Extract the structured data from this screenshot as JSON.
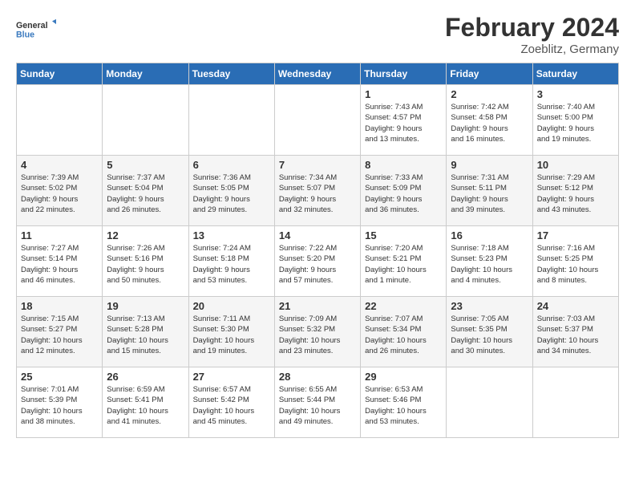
{
  "logo": {
    "text_general": "General",
    "text_blue": "Blue"
  },
  "title": "February 2024",
  "subtitle": "Zoeblitz, Germany",
  "days_of_week": [
    "Sunday",
    "Monday",
    "Tuesday",
    "Wednesday",
    "Thursday",
    "Friday",
    "Saturday"
  ],
  "weeks": [
    [
      {
        "day": "",
        "info": ""
      },
      {
        "day": "",
        "info": ""
      },
      {
        "day": "",
        "info": ""
      },
      {
        "day": "",
        "info": ""
      },
      {
        "day": "1",
        "info": "Sunrise: 7:43 AM\nSunset: 4:57 PM\nDaylight: 9 hours\nand 13 minutes."
      },
      {
        "day": "2",
        "info": "Sunrise: 7:42 AM\nSunset: 4:58 PM\nDaylight: 9 hours\nand 16 minutes."
      },
      {
        "day": "3",
        "info": "Sunrise: 7:40 AM\nSunset: 5:00 PM\nDaylight: 9 hours\nand 19 minutes."
      }
    ],
    [
      {
        "day": "4",
        "info": "Sunrise: 7:39 AM\nSunset: 5:02 PM\nDaylight: 9 hours\nand 22 minutes."
      },
      {
        "day": "5",
        "info": "Sunrise: 7:37 AM\nSunset: 5:04 PM\nDaylight: 9 hours\nand 26 minutes."
      },
      {
        "day": "6",
        "info": "Sunrise: 7:36 AM\nSunset: 5:05 PM\nDaylight: 9 hours\nand 29 minutes."
      },
      {
        "day": "7",
        "info": "Sunrise: 7:34 AM\nSunset: 5:07 PM\nDaylight: 9 hours\nand 32 minutes."
      },
      {
        "day": "8",
        "info": "Sunrise: 7:33 AM\nSunset: 5:09 PM\nDaylight: 9 hours\nand 36 minutes."
      },
      {
        "day": "9",
        "info": "Sunrise: 7:31 AM\nSunset: 5:11 PM\nDaylight: 9 hours\nand 39 minutes."
      },
      {
        "day": "10",
        "info": "Sunrise: 7:29 AM\nSunset: 5:12 PM\nDaylight: 9 hours\nand 43 minutes."
      }
    ],
    [
      {
        "day": "11",
        "info": "Sunrise: 7:27 AM\nSunset: 5:14 PM\nDaylight: 9 hours\nand 46 minutes."
      },
      {
        "day": "12",
        "info": "Sunrise: 7:26 AM\nSunset: 5:16 PM\nDaylight: 9 hours\nand 50 minutes."
      },
      {
        "day": "13",
        "info": "Sunrise: 7:24 AM\nSunset: 5:18 PM\nDaylight: 9 hours\nand 53 minutes."
      },
      {
        "day": "14",
        "info": "Sunrise: 7:22 AM\nSunset: 5:20 PM\nDaylight: 9 hours\nand 57 minutes."
      },
      {
        "day": "15",
        "info": "Sunrise: 7:20 AM\nSunset: 5:21 PM\nDaylight: 10 hours\nand 1 minute."
      },
      {
        "day": "16",
        "info": "Sunrise: 7:18 AM\nSunset: 5:23 PM\nDaylight: 10 hours\nand 4 minutes."
      },
      {
        "day": "17",
        "info": "Sunrise: 7:16 AM\nSunset: 5:25 PM\nDaylight: 10 hours\nand 8 minutes."
      }
    ],
    [
      {
        "day": "18",
        "info": "Sunrise: 7:15 AM\nSunset: 5:27 PM\nDaylight: 10 hours\nand 12 minutes."
      },
      {
        "day": "19",
        "info": "Sunrise: 7:13 AM\nSunset: 5:28 PM\nDaylight: 10 hours\nand 15 minutes."
      },
      {
        "day": "20",
        "info": "Sunrise: 7:11 AM\nSunset: 5:30 PM\nDaylight: 10 hours\nand 19 minutes."
      },
      {
        "day": "21",
        "info": "Sunrise: 7:09 AM\nSunset: 5:32 PM\nDaylight: 10 hours\nand 23 minutes."
      },
      {
        "day": "22",
        "info": "Sunrise: 7:07 AM\nSunset: 5:34 PM\nDaylight: 10 hours\nand 26 minutes."
      },
      {
        "day": "23",
        "info": "Sunrise: 7:05 AM\nSunset: 5:35 PM\nDaylight: 10 hours\nand 30 minutes."
      },
      {
        "day": "24",
        "info": "Sunrise: 7:03 AM\nSunset: 5:37 PM\nDaylight: 10 hours\nand 34 minutes."
      }
    ],
    [
      {
        "day": "25",
        "info": "Sunrise: 7:01 AM\nSunset: 5:39 PM\nDaylight: 10 hours\nand 38 minutes."
      },
      {
        "day": "26",
        "info": "Sunrise: 6:59 AM\nSunset: 5:41 PM\nDaylight: 10 hours\nand 41 minutes."
      },
      {
        "day": "27",
        "info": "Sunrise: 6:57 AM\nSunset: 5:42 PM\nDaylight: 10 hours\nand 45 minutes."
      },
      {
        "day": "28",
        "info": "Sunrise: 6:55 AM\nSunset: 5:44 PM\nDaylight: 10 hours\nand 49 minutes."
      },
      {
        "day": "29",
        "info": "Sunrise: 6:53 AM\nSunset: 5:46 PM\nDaylight: 10 hours\nand 53 minutes."
      },
      {
        "day": "",
        "info": ""
      },
      {
        "day": "",
        "info": ""
      }
    ]
  ]
}
